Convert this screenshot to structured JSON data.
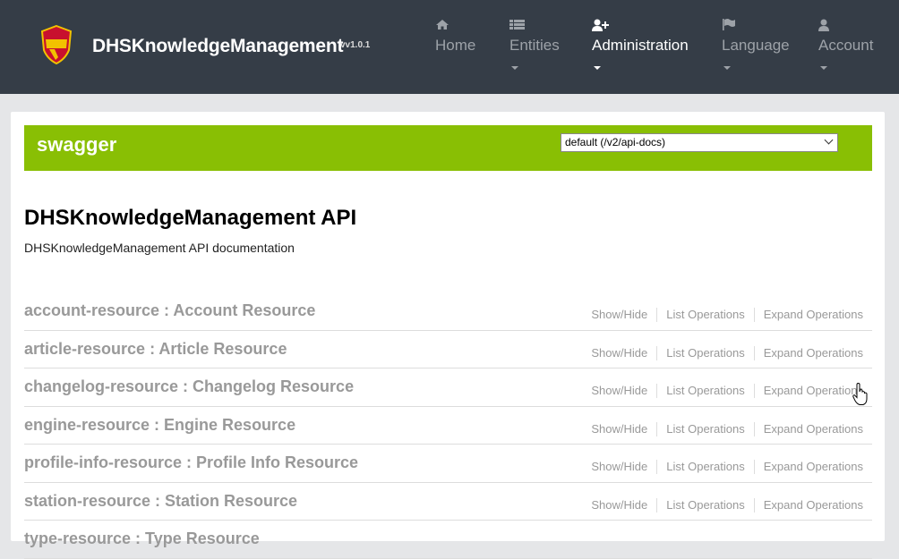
{
  "navbar": {
    "brand": "DHSKnowledgeManagement",
    "version": "vv1.0.1",
    "items": [
      {
        "label": "Home",
        "icon": "home-icon"
      },
      {
        "label": "Entities",
        "icon": "list-icon"
      },
      {
        "label": "Administration",
        "icon": "user-plus-icon"
      },
      {
        "label": "Language",
        "icon": "flag-icon"
      },
      {
        "label": "Account",
        "icon": "user-icon"
      }
    ]
  },
  "swagger": {
    "title": "swagger",
    "api_select": "default (/v2/api-docs)"
  },
  "api": {
    "title": "DHSKnowledgeManagement API",
    "description": "DHSKnowledgeManagement API documentation"
  },
  "resources": [
    {
      "name": "account-resource : Account Resource"
    },
    {
      "name": "article-resource : Article Resource"
    },
    {
      "name": "changelog-resource : Changelog Resource"
    },
    {
      "name": "engine-resource : Engine Resource"
    },
    {
      "name": "profile-info-resource : Profile Info Resource"
    },
    {
      "name": "station-resource : Station Resource"
    },
    {
      "name": "type-resource : Type Resource"
    }
  ],
  "operations": {
    "show_hide": "Show/Hide",
    "list": "List Operations",
    "expand": "Expand Operations"
  },
  "colors": {
    "navbar": "#353d47",
    "swagger_green": "#89bf04"
  }
}
